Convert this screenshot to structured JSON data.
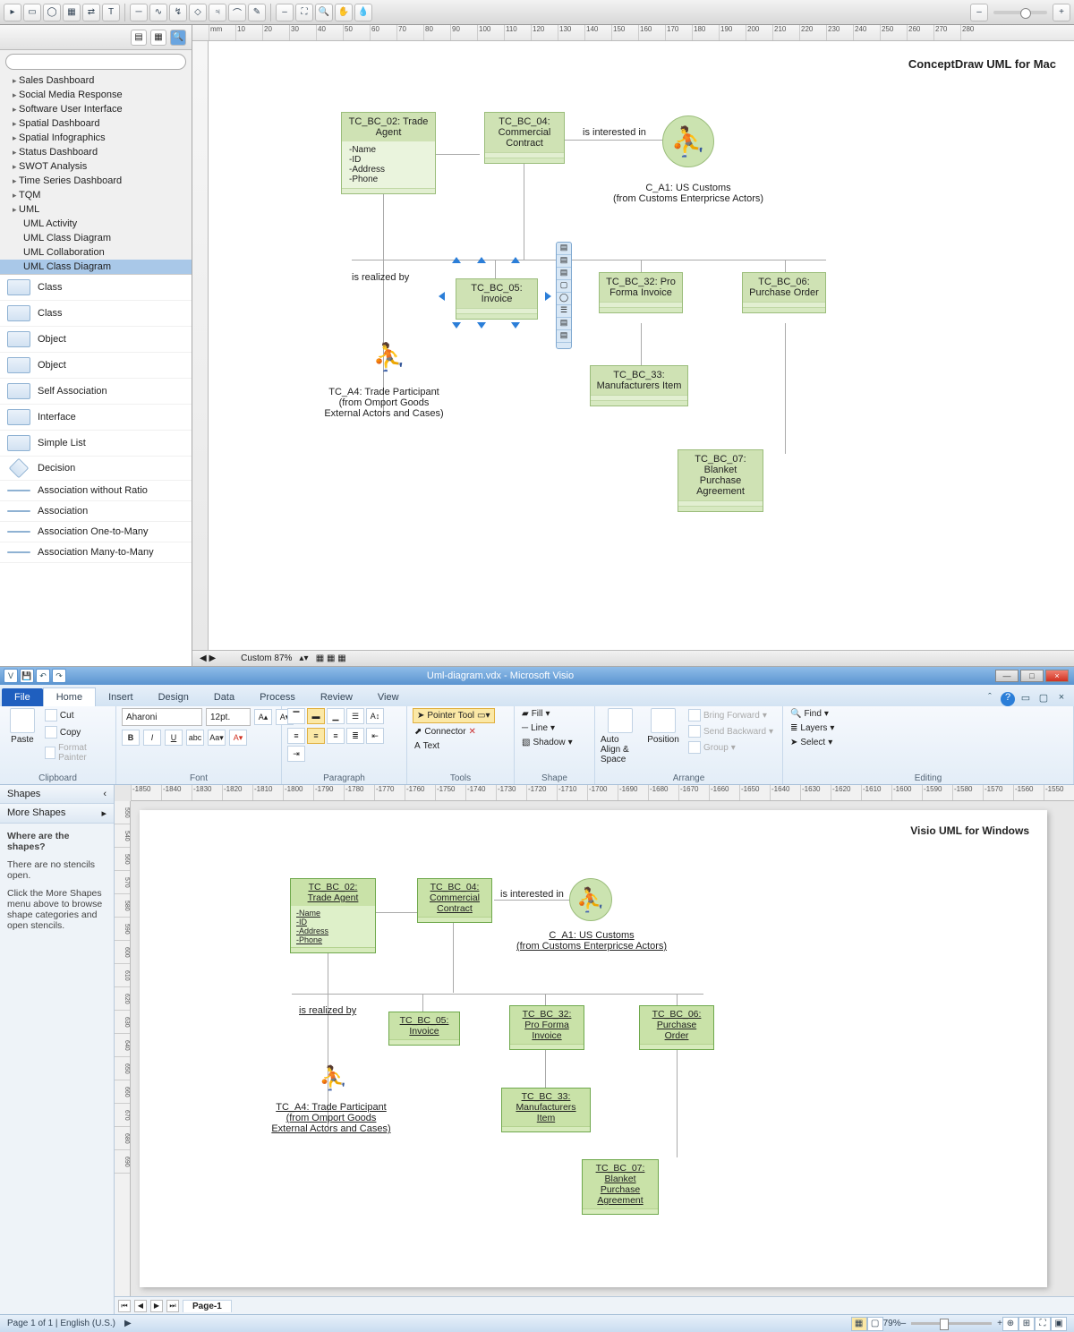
{
  "top_app": {
    "title": "ConceptDraw UML for Mac",
    "sidebar_search_placeholder": "",
    "tree": [
      "Sales Dashboard",
      "Social Media Response",
      "Software User Interface",
      "Spatial Dashboard",
      "Spatial Infographics",
      "Status Dashboard",
      "SWOT Analysis",
      "Time Series Dashboard",
      "TQM",
      "UML"
    ],
    "uml_children": [
      "UML Activity",
      "UML Class Diagram",
      "UML Collaboration",
      "UML Class Diagram"
    ],
    "uml_selected": "UML Class Diagram",
    "shapes": [
      "Class",
      "Class",
      "Object",
      "Object",
      "Self Association",
      "Interface",
      "Simple List",
      "Decision",
      "Association without Ratio",
      "Association",
      "Association One-to-Many",
      "Association Many-to-Many"
    ],
    "status_zoom": "Custom 87%",
    "ruler_h": [
      "mm",
      "10",
      "20",
      "30",
      "40",
      "50",
      "60",
      "70",
      "80",
      "90",
      "100",
      "110",
      "120",
      "130",
      "140",
      "150",
      "160",
      "170",
      "180",
      "190",
      "200",
      "210",
      "220",
      "230",
      "240",
      "250",
      "260",
      "270",
      "280"
    ],
    "diagram": {
      "tc_bc_02": {
        "title": "TC_BC_02: Trade Agent",
        "attrs": [
          "-Name",
          "-ID",
          "-Address",
          "-Phone"
        ]
      },
      "tc_bc_04": {
        "title": "TC_BC_04: Commercial Contract"
      },
      "tc_bc_05": {
        "title": "TC_BC_05: Invoice"
      },
      "tc_bc_32": {
        "title": "TC_BC_32: Pro Forma Invoice"
      },
      "tc_bc_06": {
        "title": "TC_BC_06: Purchase Order"
      },
      "tc_bc_33": {
        "title": "TC_BC_33: Manufacturers Item"
      },
      "tc_bc_07": {
        "title": "TC_BC_07: Blanket Purchase Agreement"
      },
      "actor1": {
        "label": "C_A1: US Customs",
        "sub": "(from Customs Enterpricse Actors)"
      },
      "actor2": {
        "line1": "TC_A4: Trade Participant",
        "line2": "(from Omport Goods",
        "line3": "External Actors and Cases)"
      },
      "rel_interested": "is interested in",
      "rel_realized": "is realized by"
    }
  },
  "bottom_app": {
    "window_title": "Uml-diagram.vdx - Microsoft Visio",
    "ribbon_tabs": [
      "Home",
      "Insert",
      "Design",
      "Data",
      "Process",
      "Review",
      "View"
    ],
    "ribbon_file": "File",
    "title_label": "Visio UML for Windows",
    "clipboard": {
      "paste": "Paste",
      "cut": "Cut",
      "copy": "Copy",
      "format_painter": "Format Painter",
      "label": "Clipboard"
    },
    "font": {
      "family": "Aharoni",
      "size": "12pt.",
      "label": "Font"
    },
    "paragraph": {
      "label": "Paragraph"
    },
    "tools": {
      "pointer": "Pointer Tool",
      "connector": "Connector",
      "text": "Text",
      "label": "Tools"
    },
    "shape": {
      "fill": "Fill",
      "line": "Line",
      "shadow": "Shadow",
      "label": "Shape"
    },
    "arrange": {
      "auto_align": "Auto Align & Space",
      "position": "Position",
      "bring_forward": "Bring Forward",
      "send_backward": "Send Backward",
      "group": "Group",
      "label": "Arrange"
    },
    "editing": {
      "find": "Find",
      "layers": "Layers",
      "select": "Select",
      "label": "Editing"
    },
    "shapes_pane": {
      "header": "Shapes",
      "more": "More Shapes",
      "q": "Where are the shapes?",
      "p1": "There are no stencils open.",
      "p2": "Click the More Shapes menu above to browse shape categories and open stencils."
    },
    "ruler_h": [
      "-1850",
      "-1840",
      "-1830",
      "-1820",
      "-1810",
      "-1800",
      "-1790",
      "-1780",
      "-1770",
      "-1760",
      "-1750",
      "-1740",
      "-1730",
      "-1720",
      "-1710",
      "-1700",
      "-1690",
      "-1680",
      "-1670",
      "-1660",
      "-1650",
      "-1640",
      "-1630",
      "-1620",
      "-1610",
      "-1600",
      "-1590",
      "-1580",
      "-1570",
      "-1560",
      "-1550"
    ],
    "ruler_v": [
      "550",
      "540",
      "560",
      "570",
      "580",
      "590",
      "600",
      "610",
      "620",
      "630",
      "640",
      "650",
      "660",
      "670",
      "680",
      "690"
    ],
    "page_tab": "Page-1",
    "status": {
      "page": "Page 1 of 1",
      "lang": "English (U.S.)",
      "zoom": "79%"
    },
    "diagram": {
      "tc_bc_02": {
        "title": "TC_BC_02: Trade Agent",
        "attrs": [
          "-Name",
          "-ID",
          "-Address",
          "-Phone"
        ]
      },
      "tc_bc_04": {
        "title": "TC_BC_04: Commercial Contract"
      },
      "tc_bc_05": {
        "title": "TC_BC_05: Invoice"
      },
      "tc_bc_32": {
        "title": "TC_BC_32: Pro Forma Invoice"
      },
      "tc_bc_06": {
        "title": "TC_BC_06: Purchase Order"
      },
      "tc_bc_33": {
        "title": "TC_BC_33: Manufacturers Item"
      },
      "tc_bc_07": {
        "title": "TC_BC_07: Blanket Purchase Agreement"
      },
      "actor1": {
        "label": "C_A1: US Customs",
        "sub": "(from Customs Enterpricse Actors)"
      },
      "actor2": {
        "line1": "TC_A4: Trade Participant",
        "line2": "(from Omport Goods",
        "line3": "External Actors and Cases)"
      },
      "rel_interested": "is interested in",
      "rel_realized": "is realized by"
    }
  }
}
